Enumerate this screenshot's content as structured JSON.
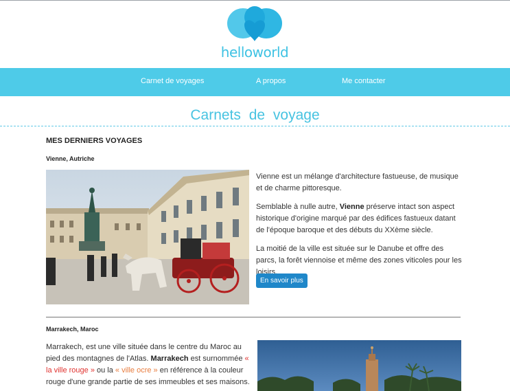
{
  "brand": {
    "logo_text": "helloworld",
    "accent": "#4ecbe8"
  },
  "nav": {
    "items": [
      "Carnet de voyages",
      "A propos",
      "Me contacter"
    ]
  },
  "page": {
    "title": "Carnets  de  voyage"
  },
  "section": {
    "heading": "MES DERNIERS VOYAGES"
  },
  "trips": {
    "vienna": {
      "place": "Vienne, Autriche",
      "p1": "Vienne est un mélange d'architecture fastueuse, de musique et de charme pittoresque.",
      "p2_before": "Semblable à nulle autre, ",
      "p2_bold": "Vienne",
      "p2_after": " préserve intact son aspect historique d'origine marqué par des édifices fastueux datant de l'époque baroque et des débuts du XXème siècle.",
      "p3": "La moitié de la ville est située sur le Danube et offre des parcs, la forêt viennoise et même des zones viticoles pour les loisirs.",
      "button": "En savoir plus",
      "button_color": "#1f87c9"
    },
    "marrakech": {
      "place": "Marrakech, Maroc",
      "t1": "Marrakech, est une ville située dans le centre du Maroc au pied des montagnes de l'Atlas. ",
      "t_bold": "Marrakech",
      "t2": " est surnommée ",
      "t_red1": "« la ville rouge »",
      "t3": " ou la ",
      "t_red2": "« ville ocre »",
      "t4": " en référence à la couleur rouge d'une grande partie de ses immeubles et ses maisons."
    }
  }
}
